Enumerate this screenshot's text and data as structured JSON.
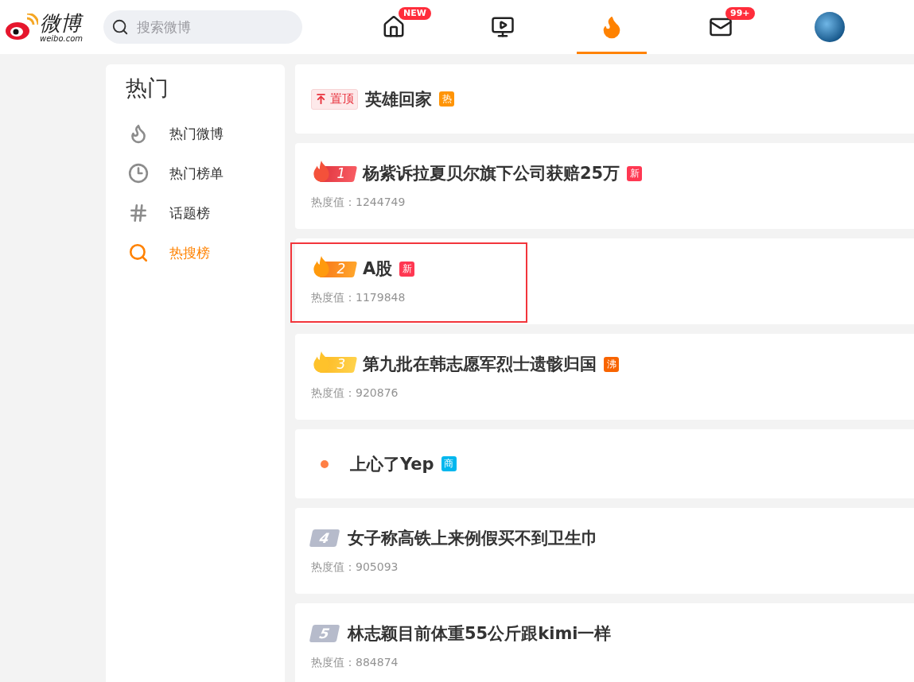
{
  "header": {
    "logo_text": "微博",
    "logo_domain": "weibo.com",
    "search": {
      "placeholder": "搜索微博"
    },
    "nav": [
      {
        "kind": "home",
        "selected": false,
        "badge": "NEW"
      },
      {
        "kind": "video",
        "selected": false
      },
      {
        "kind": "hot",
        "selected": true
      },
      {
        "kind": "mail",
        "selected": false,
        "badge": "99+"
      },
      {
        "kind": "avatar",
        "selected": false
      }
    ]
  },
  "sidebar": {
    "title": "热门",
    "items": [
      {
        "kind": "flame",
        "label": "热门微博",
        "selected": false
      },
      {
        "kind": "clock",
        "label": "热门榜单",
        "selected": false
      },
      {
        "kind": "hash",
        "label": "话题榜",
        "selected": false
      },
      {
        "kind": "search",
        "label": "热搜榜",
        "selected": true
      }
    ]
  },
  "list": [
    {
      "kind": "pinned",
      "pin_label": "置顶",
      "title": "英雄回家",
      "tag": {
        "text": "热",
        "color": "#ff9406"
      },
      "highlighted": false
    },
    {
      "kind": "top",
      "rank": "1",
      "title": "杨紫诉拉夏贝尔旗下公司获赔25万",
      "tag": {
        "text": "新",
        "color": "#ff3852"
      },
      "heat": "热度值：1244749",
      "highlighted": false
    },
    {
      "kind": "top",
      "rank": "2",
      "title": "A股",
      "tag": {
        "text": "新",
        "color": "#ff3852"
      },
      "heat": "热度值：1179848",
      "highlighted": true
    },
    {
      "kind": "top",
      "rank": "3",
      "title": "第九批在韩志愿军烈士遗骸归国",
      "tag": {
        "text": "沸",
        "color": "#f86400"
      },
      "heat": "热度值：920876",
      "highlighted": false
    },
    {
      "kind": "ad",
      "title": "上心了Yep",
      "tag": {
        "text": "商",
        "color": "#00b7ee"
      },
      "highlighted": false
    },
    {
      "kind": "rank",
      "rank": "4",
      "title": "女子称高铁上来例假买不到卫生巾",
      "heat": "热度值：905093",
      "highlighted": false
    },
    {
      "kind": "rank",
      "rank": "5",
      "title": "林志颖目前体重55公斤跟kimi一样",
      "heat": "热度值：884874",
      "highlighted": false
    }
  ]
}
